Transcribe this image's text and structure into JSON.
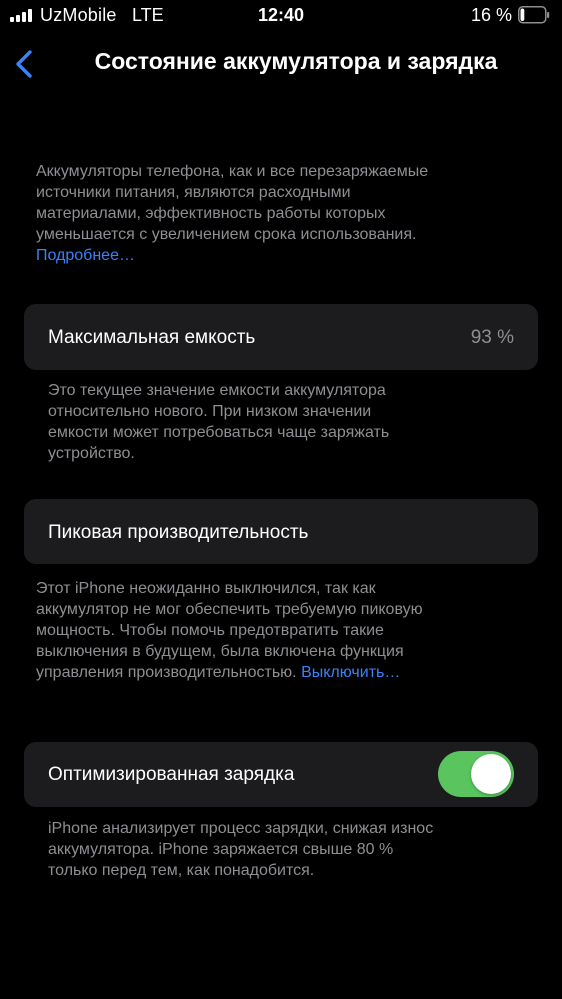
{
  "status_bar": {
    "carrier": "UzMobile",
    "network": "LTE",
    "time": "12:40",
    "battery_percent": "16 %",
    "battery_level": 0.16
  },
  "nav": {
    "title": "Состояние аккумулятора и зарядка",
    "back_icon": "chevron-left-icon"
  },
  "intro": {
    "lines": [
      "Аккумуляторы телефона, как и все перезаряжаемые",
      "источники питания, являются расходными",
      "материалами, эффективность работы которых",
      "уменьшается с увеличением срока использования."
    ],
    "link": "Подробнее…"
  },
  "max_capacity": {
    "label": "Максимальная емкость",
    "value": "93 %",
    "footer_lines": [
      "Это текущее значение емкости аккумулятора",
      "относительно нового. При низком значении",
      "емкости может потребоваться чаще заряжать",
      "устройство."
    ]
  },
  "peak_performance": {
    "label": "Пиковая производительность",
    "footer_lines": [
      "Этот iPhone неожиданно выключился, так как",
      "аккумулятор не мог обеспечить требуемую пиковую",
      "мощность. Чтобы помочь предотвратить такие",
      "выключения в будущем, была включена функция"
    ],
    "footer_last": "управления производительностью.",
    "disable_link": "Выключить…"
  },
  "optimized_charging": {
    "label": "Оптимизированная зарядка",
    "enabled": true,
    "footer_lines": [
      "iPhone анализирует процесс зарядки, снижая износ",
      "аккумулятора. iPhone заряжается свыше 80 %",
      "только перед тем, как понадобится."
    ]
  },
  "colors": {
    "background": "#000000",
    "cell": "#1c1c1e",
    "secondary_text": "#8e8e93",
    "link": "#3a82f7",
    "toggle_on": "#5ac55f",
    "battery_fill": "#ffffff"
  }
}
